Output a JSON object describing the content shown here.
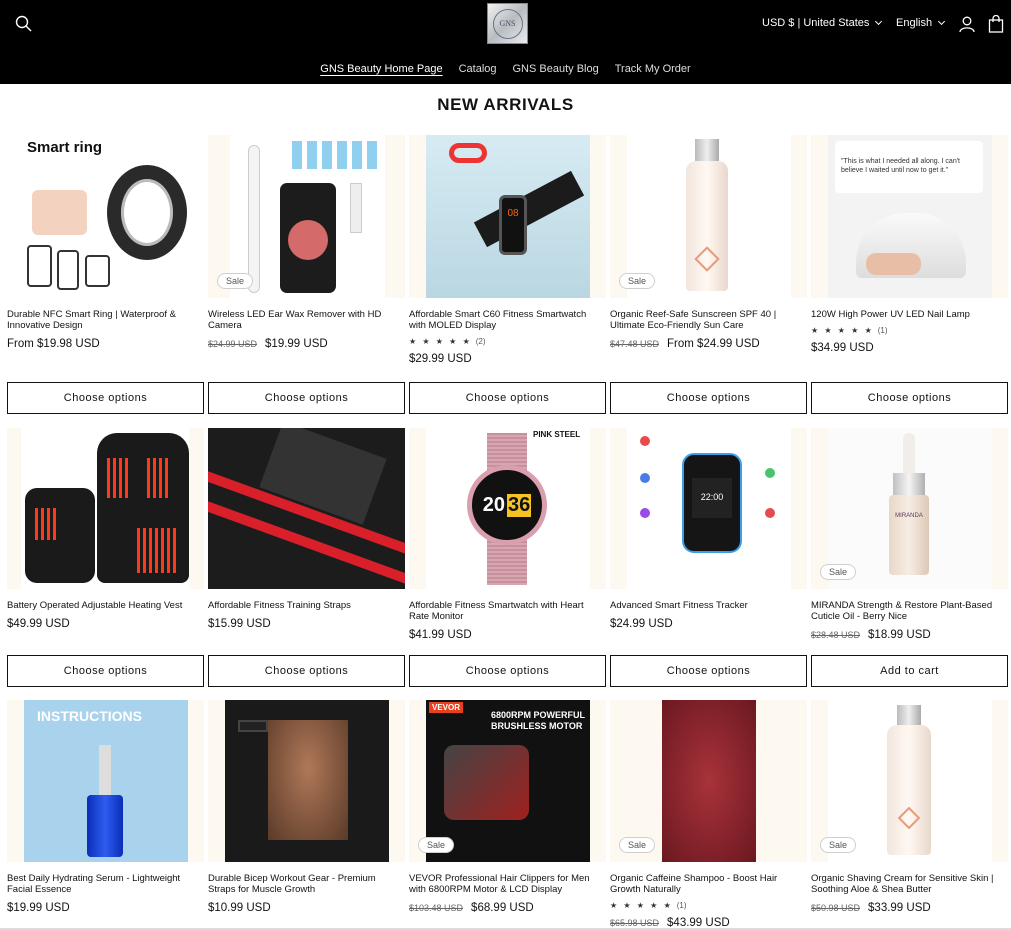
{
  "header": {
    "logo_text": "GNS",
    "currency": "USD $ | United States",
    "language": "English",
    "nav": [
      {
        "label": "GNS Beauty Home Page"
      },
      {
        "label": "Catalog"
      },
      {
        "label": "GNS Beauty Blog"
      },
      {
        "label": "Track My Order"
      }
    ]
  },
  "section_title": "NEW ARRIVALS",
  "products": [
    {
      "title": "Durable NFC Smart Ring | Waterproof & Innovative Design",
      "price": "From $19.98 USD",
      "button": "Choose options",
      "image_label": "Smart ring"
    },
    {
      "title": "Wireless LED Ear Wax Remover with HD Camera",
      "was": "$24.99 USD",
      "price": "$19.99 USD",
      "badge": "Sale",
      "button": "Choose options"
    },
    {
      "title": "Affordable Smart C60 Fitness Smartwatch with MOLED Display",
      "stars": "★ ★ ★ ★ ★",
      "rating_count": "(2)",
      "price": "$29.99 USD",
      "button": "Choose options"
    },
    {
      "title": "Organic Reef-Safe Sunscreen SPF 40 | Ultimate Eco-Friendly Sun Care",
      "was": "$47.48 USD",
      "price": "From $24.99 USD",
      "badge": "Sale",
      "button": "Choose options"
    },
    {
      "title": "120W High Power UV LED Nail Lamp",
      "stars": "★ ★ ★ ★ ★",
      "rating_count": "(1)",
      "price": "$34.99 USD",
      "button": "Choose options",
      "image_quote": "\"This is what I needed all along. I can't believe I waited until now to get it.\""
    },
    {
      "title": "Battery Operated Adjustable Heating Vest",
      "price": "$49.99 USD",
      "button": "Choose options"
    },
    {
      "title": "Affordable Fitness Training Straps",
      "price": "$15.99 USD",
      "button": "Choose options"
    },
    {
      "title": "Affordable Fitness Smartwatch with Heart Rate Monitor",
      "price": "$41.99 USD",
      "button": "Choose options",
      "image_label": "PINK STEEL"
    },
    {
      "title": "Advanced Smart Fitness Tracker",
      "price": "$24.99 USD",
      "button": "Choose options"
    },
    {
      "title": "MIRANDA Strength & Restore Plant-Based Cuticle Oil - Berry Nice",
      "was": "$28.48 USD",
      "price": "$18.99 USD",
      "badge": "Sale",
      "button": "Add to cart",
      "image_label": "MIRANDA"
    },
    {
      "title": "Best Daily Hydrating Serum - Lightweight Facial Essence",
      "price": "$19.99 USD",
      "image_label": "INSTRUCTIONS"
    },
    {
      "title": "Durable Bicep Workout Gear - Premium Straps for Muscle Growth",
      "price": "$10.99 USD"
    },
    {
      "title": "VEVOR Professional Hair Clippers for Men with 6800RPM Motor & LCD Display",
      "was": "$103.48 USD",
      "price": "$68.99 USD",
      "badge": "Sale",
      "image_label": "6800RPM POWERFUL BRUSHLESS MOTOR",
      "image_brand": "VEVOR"
    },
    {
      "title": "Organic Caffeine Shampoo - Boost Hair Growth Naturally",
      "stars": "★ ★ ★ ★ ★",
      "rating_count": "(1)",
      "was": "$65.98 USD",
      "price": "$43.99 USD",
      "badge": "Sale"
    },
    {
      "title": "Organic Shaving Cream for Sensitive Skin | Soothing Aloe & Shea Butter",
      "was": "$50.98 USD",
      "price": "$33.99 USD",
      "badge": "Sale"
    }
  ],
  "colors": {
    "header_bg": "#000000",
    "accent": "#e63b2a",
    "card_bg": "#fdf9f1"
  }
}
